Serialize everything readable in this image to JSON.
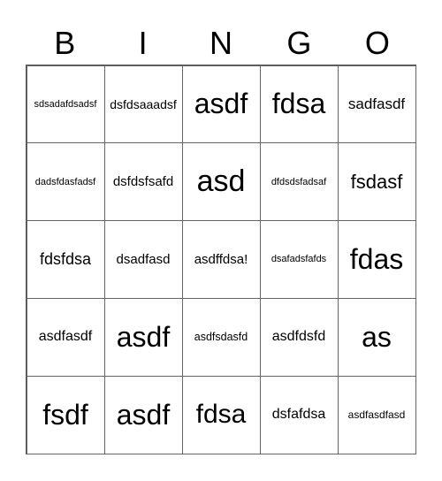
{
  "header": [
    "B",
    "I",
    "N",
    "G",
    "O"
  ],
  "cells": [
    [
      "sdsadafdsadsf",
      "dsfdsaaadsf",
      "asdf",
      "fdsa",
      "sadfasdf"
    ],
    [
      "dadsfdasfadsf",
      "dsfdsfsafd",
      "asd",
      "dfdsdsfadsaf",
      "fsdasf"
    ],
    [
      "fdsfdsa",
      "dsadfasd",
      "asdffdsa!",
      "dsafadsfafds",
      "fdas"
    ],
    [
      "asdfasdf",
      "asdf",
      "asdfsdasfd",
      "asdfdsfd",
      "as"
    ],
    [
      "fsdf",
      "asdf",
      "fdsa",
      "dsfafdsa",
      "asdfasdfasd"
    ]
  ]
}
